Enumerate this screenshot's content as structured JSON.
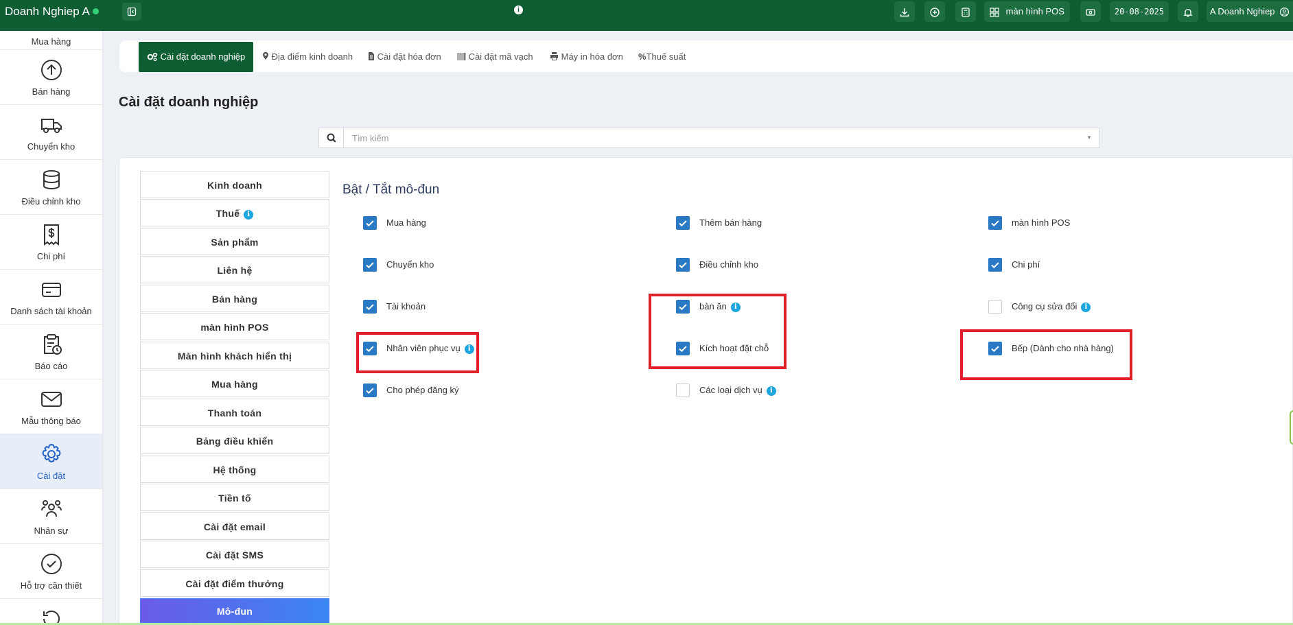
{
  "topbar": {
    "brand": "Doanh Nghiep A",
    "pos_label": "màn hình POS",
    "date": "20-08-2025",
    "user": "A Doanh Nghiep"
  },
  "sidebar": {
    "items": [
      {
        "label": "Mua hàng",
        "icon": "cart-icon"
      },
      {
        "label": "Bán hàng",
        "icon": "upload-icon"
      },
      {
        "label": "Chuyển kho",
        "icon": "truck-icon"
      },
      {
        "label": "Điều chỉnh kho",
        "icon": "database-icon"
      },
      {
        "label": "Chi phí",
        "icon": "receipt-dollar-icon"
      },
      {
        "label": "Danh sách tài khoản",
        "icon": "card-icon"
      },
      {
        "label": "Báo cáo",
        "icon": "clipboard-clock-icon"
      },
      {
        "label": "Mẫu thông báo",
        "icon": "mail-icon"
      },
      {
        "label": "Cài đặt",
        "icon": "gear-icon"
      },
      {
        "label": "Nhân sự",
        "icon": "users-icon"
      },
      {
        "label": "Hỗ trợ cần thiết",
        "icon": "check-circle-icon"
      }
    ]
  },
  "tabs": [
    {
      "label": "Cài đặt doanh nghiệp",
      "icon": "cogs-icon"
    },
    {
      "label": "Địa điểm kinh doanh",
      "icon": "map-pin-icon"
    },
    {
      "label": "Cài đặt hóa đơn",
      "icon": "file-icon"
    },
    {
      "label": "Cài đặt mã vạch",
      "icon": "barcode-icon"
    },
    {
      "label": "Máy in hóa đơn",
      "icon": "printer-icon"
    },
    {
      "label": "Thuế suất",
      "icon": "percent-icon"
    }
  ],
  "page_title": "Cài đặt doanh nghiệp",
  "search": {
    "placeholder": "Tìm kiếm"
  },
  "menu": [
    "Kinh doanh",
    "Thuế",
    "Sản phẩm",
    "Liên hệ",
    "Bán hàng",
    "màn hình POS",
    "Màn hình khách hiển thị",
    "Mua hàng",
    "Thanh toán",
    "Bảng điều khiển",
    "Hệ thống",
    "Tiền tố",
    "Cài đặt email",
    "Cài đặt SMS",
    "Cài đặt điểm thưởng",
    "Mô-đun"
  ],
  "section_title": "Bật / Tắt mô-đun",
  "modules": [
    {
      "label": "Mua hàng",
      "checked": true
    },
    {
      "label": "Thêm bán hàng",
      "checked": true
    },
    {
      "label": "màn hình POS",
      "checked": true
    },
    {
      "label": "Chuyển kho",
      "checked": true
    },
    {
      "label": "Điều chỉnh kho",
      "checked": true
    },
    {
      "label": "Chi phí",
      "checked": true
    },
    {
      "label": "Tài khoản",
      "checked": true
    },
    {
      "label": "bàn ăn",
      "checked": true
    },
    {
      "label": "Công cụ sửa đổi",
      "checked": false
    },
    {
      "label": "Nhân viên phục vụ",
      "checked": true
    },
    {
      "label": "Kích hoạt đặt chỗ",
      "checked": true
    },
    {
      "label": "Bếp (Dành cho nhà hàng)",
      "checked": true
    },
    {
      "label": "Cho phép đăng ký",
      "checked": true
    },
    {
      "label": "Các loại dịch vụ",
      "checked": false
    }
  ],
  "colors": {
    "topbar": "#0f5e33",
    "checkbox": "#2a79c4",
    "highlight": "#e0202a",
    "info": "#1ea6e0"
  }
}
